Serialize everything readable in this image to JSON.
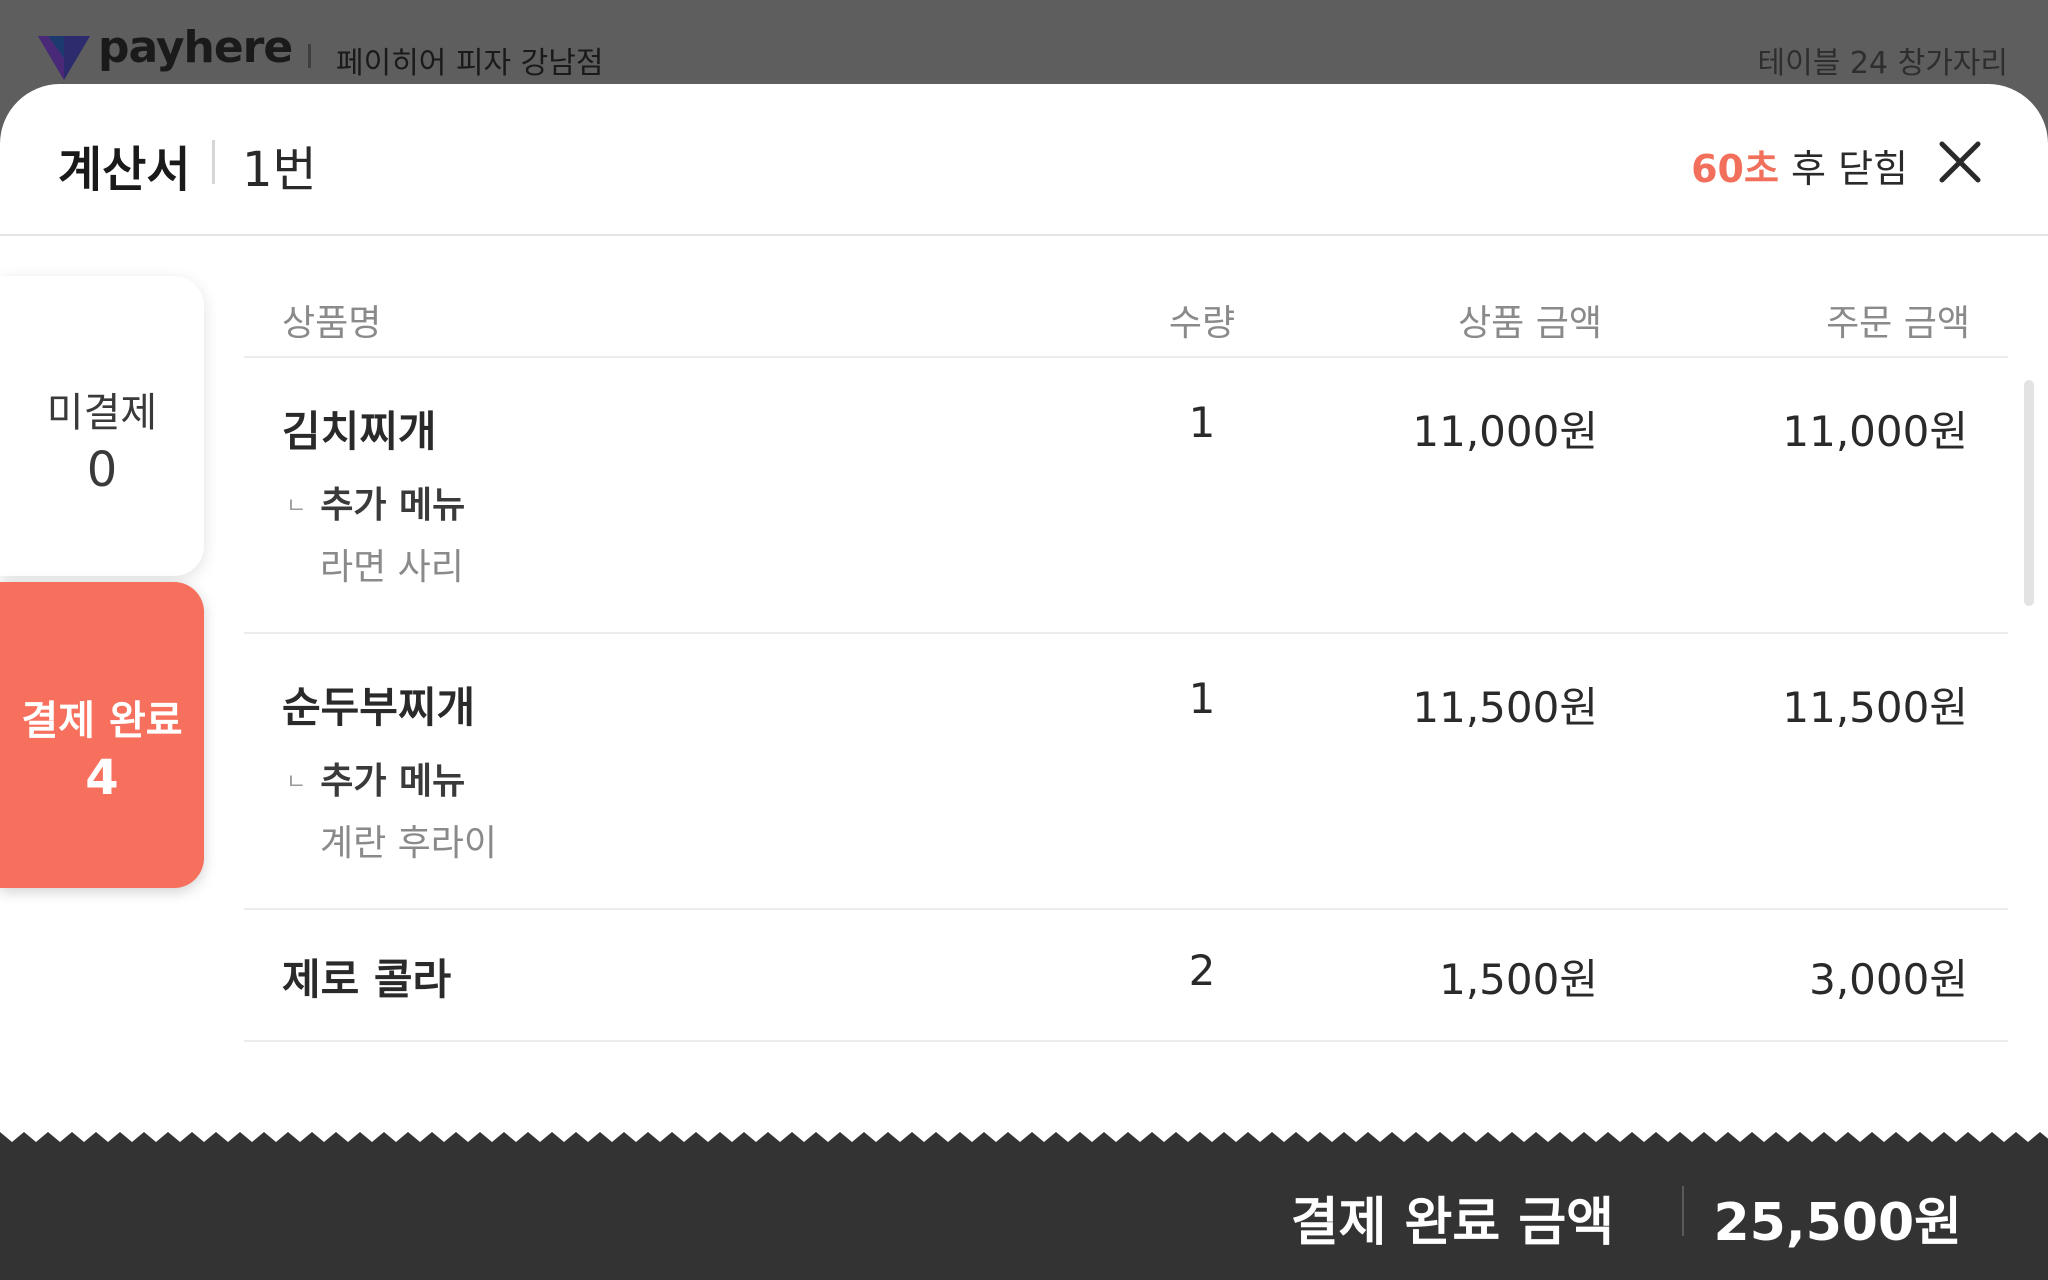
{
  "appbar": {
    "brand": "payhere",
    "store": "페이히어 피자 강남점",
    "table_info": "테이블 24 창가자리"
  },
  "header": {
    "title": "계산서",
    "bill_number": "1번",
    "countdown_seconds": "60초",
    "countdown_suffix": " 후 닫힘"
  },
  "tabs": {
    "unpaid": {
      "label": "미결제",
      "count": "0"
    },
    "paid": {
      "label": "결제 완료",
      "count": "4"
    }
  },
  "table": {
    "columns": [
      "상품명",
      "수량",
      "상품 금액",
      "주문 금액"
    ],
    "rows": [
      {
        "name": "김치찌개",
        "qty": "1",
        "price": "11,000원",
        "total": "11,000원",
        "addon_label": "추가 메뉴",
        "addon_item": "라면 사리"
      },
      {
        "name": "순두부찌개",
        "qty": "1",
        "price": "11,500원",
        "total": "11,500원",
        "addon_label": "추가 메뉴",
        "addon_item": "계란 후라이"
      },
      {
        "name": "제로 콜라",
        "qty": "2",
        "price": "1,500원",
        "total": "3,000원"
      }
    ]
  },
  "footer": {
    "label": "결제 완료 금액",
    "value": "25,500원"
  },
  "colors": {
    "accent": "#f6705d",
    "footer_bg": "#333333",
    "backdrop": "#5e5e5e"
  },
  "icons": {
    "logo": "payhere-logo-icon",
    "close": "close-icon",
    "addon": "addon-branch-icon"
  }
}
